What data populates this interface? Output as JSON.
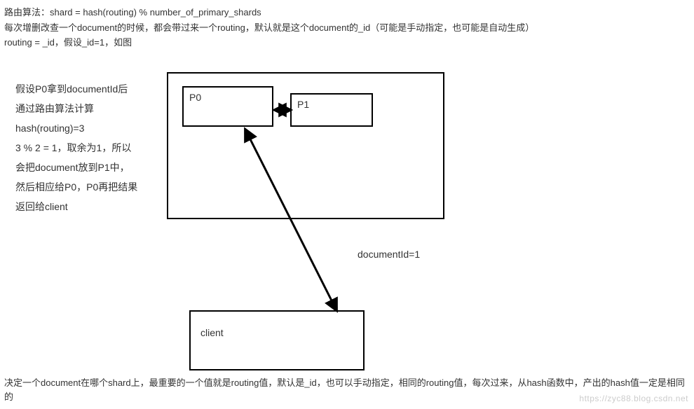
{
  "intro": {
    "line1": "路由算法：shard = hash(routing) % number_of_primary_shards",
    "line2": "每次增删改查一个document的时候，都会带过来一个routing，默认就是这个document的_id（可能是手动指定，也可能是自动生成）",
    "line3": "routing = _id，假设_id=1，如图"
  },
  "explanation": {
    "l1": "假设P0拿到documentId后",
    "l2": "通过路由算法计算",
    "l3": "hash(routing)=3",
    "l4": "3 % 2 = 1，取余为1，所以",
    "l5": "会把document放到P1中，",
    "l6": "然后相应给P0，P0再把结果",
    "l7": "返回给client"
  },
  "shards": {
    "p0": "P0",
    "p1": "P1"
  },
  "client_label": "client",
  "arrow_label": "documentId=1",
  "outro": "决定一个document在哪个shard上，最重要的一个值就是routing值，默认是_id，也可以手动指定，相同的routing值，每次过来，从hash函数中，产出的hash值一定是相同的",
  "watermark": "https://zyc88.blog.csdn.net"
}
